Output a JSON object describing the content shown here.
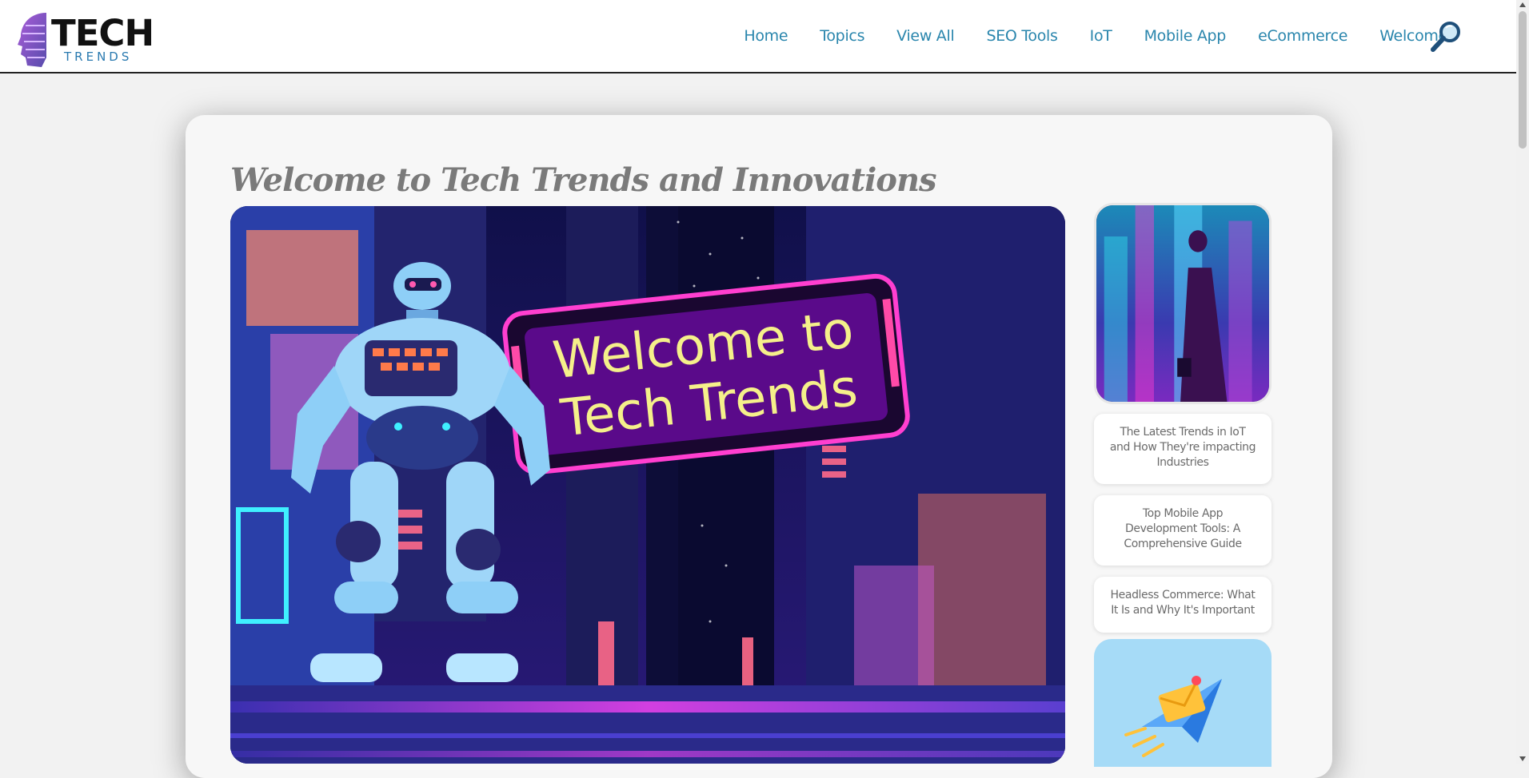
{
  "brand": {
    "name": "TECH",
    "tagline": "TRENDS",
    "accent": "#2a86ad"
  },
  "nav": {
    "items": [
      {
        "label": "Home"
      },
      {
        "label": "Topics"
      },
      {
        "label": "View All"
      },
      {
        "label": "SEO Tools"
      },
      {
        "label": "IoT"
      },
      {
        "label": "Mobile App"
      },
      {
        "label": "eCommerce"
      },
      {
        "label": "Welcome"
      }
    ],
    "search_icon": "magnifier-icon"
  },
  "main": {
    "title": "Welcome to Tech Trends and Innovations",
    "hero_sign_line1": "Welcome to",
    "hero_sign_line2": "Tech Trends"
  },
  "sidebar": {
    "posts": [
      {
        "title": "The Latest Trends in IoT and How They're impacting Industries"
      },
      {
        "title": "Top Mobile App Development Tools: A Comprehensive Guide"
      },
      {
        "title": "Headless Commerce: What It Is and Why It's Important"
      }
    ],
    "newsletter_icon": "paper-plane-envelope-icon"
  },
  "colors": {
    "nav_link": "#2a86ad",
    "title": "#7a7a7a",
    "neon_pink": "#ff3fd0",
    "sign_text": "#f5f08a"
  }
}
